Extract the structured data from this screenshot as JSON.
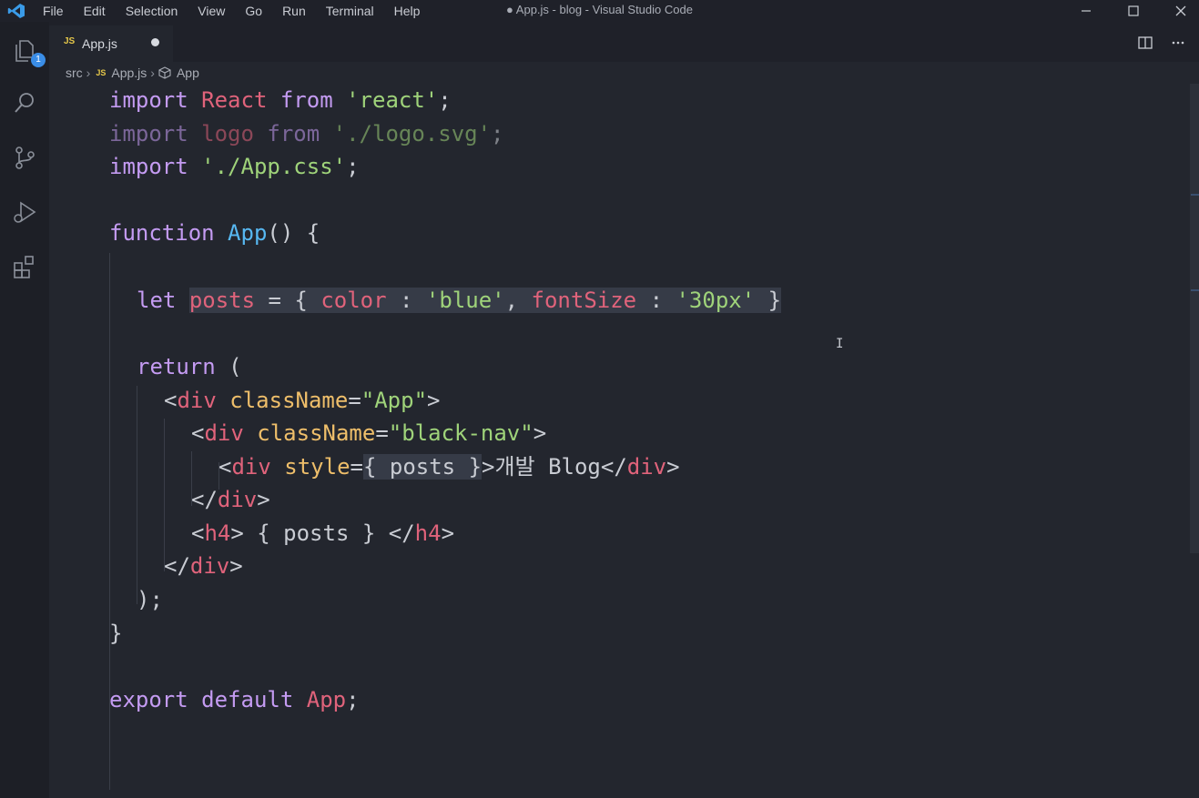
{
  "window": {
    "title": "● App.js - blog - Visual Studio Code",
    "menu": [
      "File",
      "Edit",
      "Selection",
      "View",
      "Go",
      "Run",
      "Terminal",
      "Help"
    ]
  },
  "activity_bar": {
    "explorer_badge": "1",
    "icons": [
      "files-icon",
      "search-icon",
      "source-control-icon",
      "run-debug-icon",
      "extensions-icon"
    ]
  },
  "tab": {
    "file_type": "JS",
    "label": "App.js",
    "modified": true
  },
  "breadcrumb": {
    "folder": "src",
    "file_type": "JS",
    "file": "App.js",
    "symbol": "App"
  },
  "code": {
    "import_react": {
      "kw1": "import",
      "name": "React",
      "kw2": "from",
      "str": "'react'",
      "end": ";"
    },
    "import_logo": {
      "kw1": "import",
      "name": "logo",
      "kw2": "from",
      "str": "'./logo.svg'",
      "end": ";"
    },
    "import_css": {
      "kw1": "import",
      "str": "'./App.css'",
      "end": ";"
    },
    "func": {
      "kw": "function",
      "name": "App",
      "rest": "() {"
    },
    "let": {
      "kw": "let",
      "name": "posts",
      "eq": " = { ",
      "k1": "color",
      "c1": " : ",
      "v1": "'blue'",
      "comma": ", ",
      "k2": "fontSize",
      "c2": " : ",
      "v2": "'30px'",
      "end": " }"
    },
    "ret": {
      "kw": "return",
      "rest": " ("
    },
    "div1": {
      "open": "<",
      "tag": "div",
      "attr": "className",
      "eq": "=",
      "val": "\"App\"",
      "close": ">"
    },
    "div2": {
      "open": "<",
      "tag": "div",
      "attr": "className",
      "eq": "=",
      "val": "\"black-nav\"",
      "close": ">"
    },
    "div3": {
      "open": "<",
      "tag": "div",
      "attr": "style",
      "eq": "=",
      "expr": "{ posts }",
      "text": ">개발 Blog</",
      "tag2": "div",
      "close": ">"
    },
    "div2_close": {
      "open": "</",
      "tag": "div",
      "close": ">"
    },
    "h4": {
      "open": "<",
      "tag": "h4",
      "mid": "> { posts } </",
      "tag2": "h4",
      "close": ">"
    },
    "div1_close": {
      "open": "</",
      "tag": "div",
      "close": ">"
    },
    "paren_close": ");",
    "brace_close": "}",
    "export": {
      "kw1": "export",
      "kw2": "default",
      "name": "App",
      "end": ";"
    }
  },
  "colors": {
    "keyword": "#c49bf2",
    "identifier": "#e0637b",
    "string": "#9fd37a",
    "function": "#57b8f2",
    "attribute": "#eebe6a",
    "background": "#23262e"
  }
}
